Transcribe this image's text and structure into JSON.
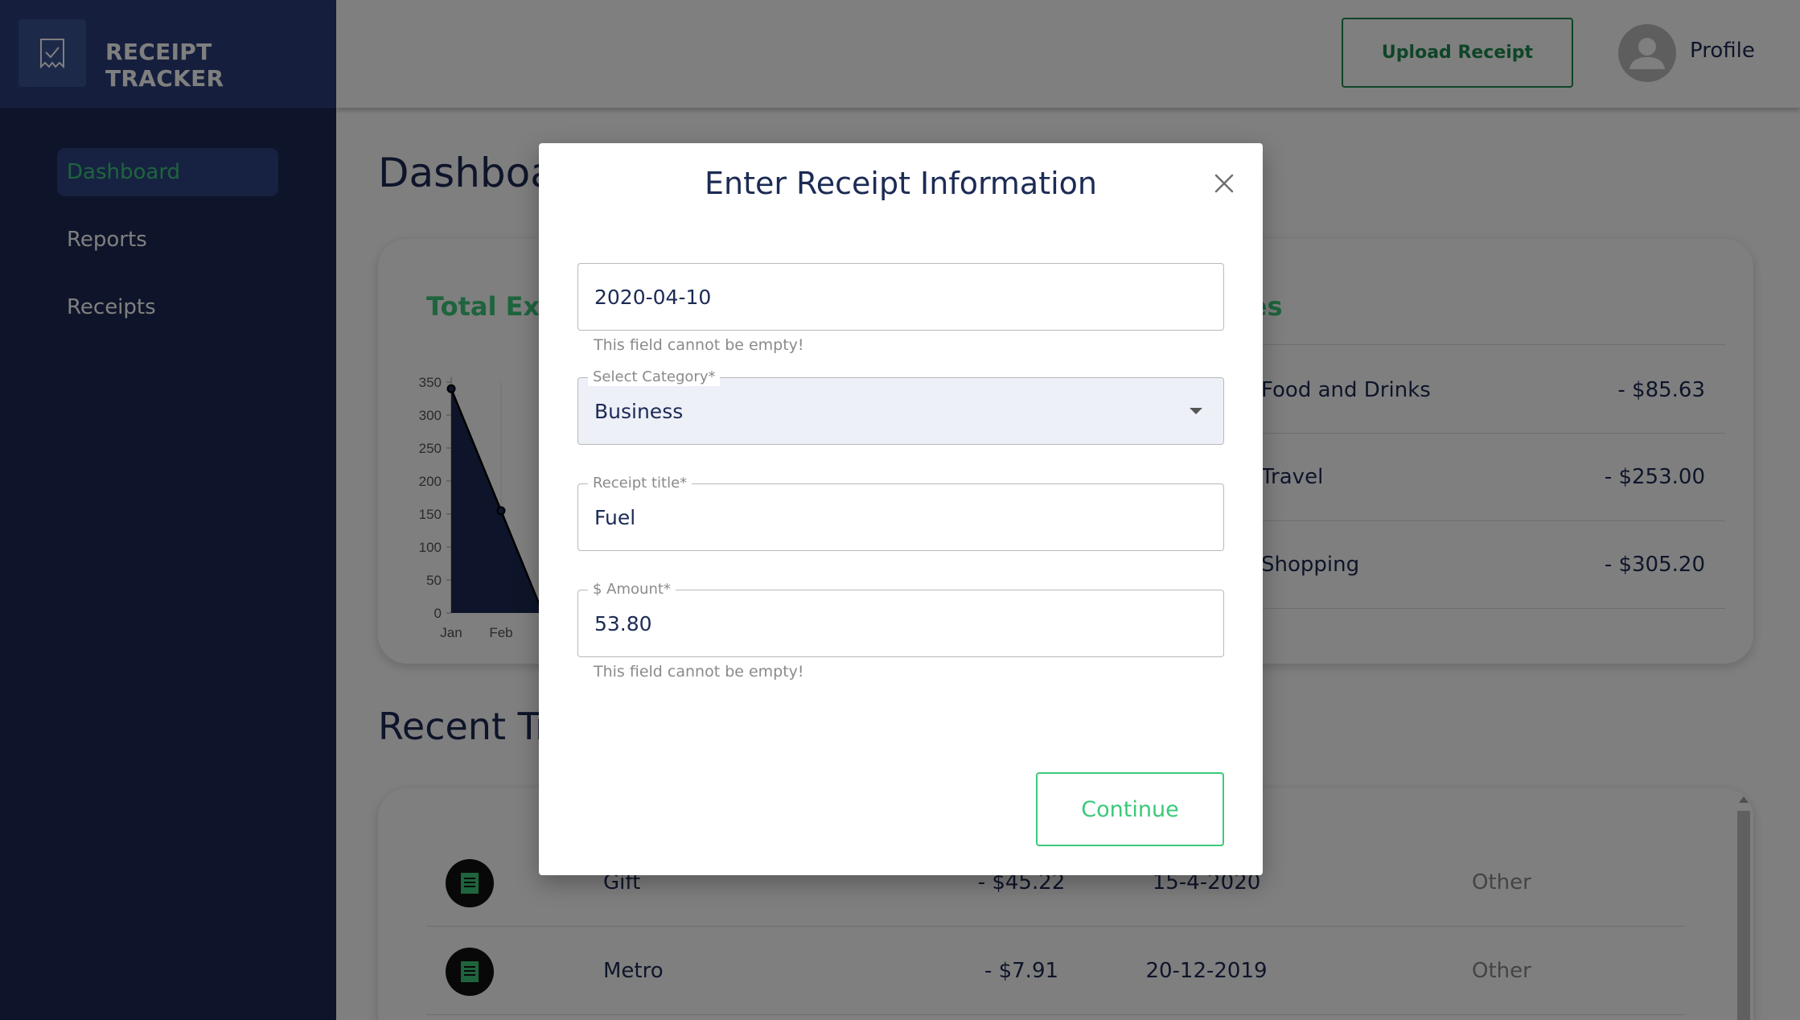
{
  "app": {
    "brand": "RECEIPT TRACKER"
  },
  "sidebar": {
    "items": [
      {
        "label": "Dashboard",
        "active": true
      },
      {
        "label": "Reports",
        "active": false
      },
      {
        "label": "Receipts",
        "active": false
      }
    ]
  },
  "topbar": {
    "upload_label": "Upload Receipt",
    "profile_label": "Profile"
  },
  "main": {
    "title": "Dashboa",
    "expense_title": "Total Exp",
    "categories_title": "ories",
    "categories": [
      {
        "name": "Food and Drinks",
        "amount": "- $85.63"
      },
      {
        "name": "Travel",
        "amount": "- $253.00"
      },
      {
        "name": "Shopping",
        "amount": "- $305.20"
      }
    ],
    "recent_title": "Recent Tr",
    "transactions": [
      {
        "title": "Gift",
        "amount": "- $45.22",
        "date": "15-4-2020",
        "category": "Other"
      },
      {
        "title": "Metro",
        "amount": "- $7.91",
        "date": "20-12-2019",
        "category": "Other"
      }
    ]
  },
  "chart_data": {
    "type": "area",
    "x": [
      "Jan",
      "Feb"
    ],
    "series": [
      {
        "values": [
          340,
          155
        ]
      }
    ],
    "yticks": [
      0,
      50,
      100,
      150,
      200,
      250,
      300,
      350
    ],
    "ylim": [
      0,
      350
    ],
    "grid": true,
    "fill_color": "#1c2b55"
  },
  "modal": {
    "title": "Enter Receipt Information",
    "date_value": "2020-04-10",
    "date_helper": "This field cannot be empty!",
    "category_label": "Select Category*",
    "category_value": "Business",
    "title_label": "Receipt title*",
    "title_value": "Fuel",
    "amount_label": "$ Amount*",
    "amount_value": "53.80",
    "amount_helper": "This field cannot be empty!",
    "continue_label": "Continue"
  },
  "colors": {
    "navy": "#1c2b55",
    "green": "#3cc97a",
    "dark_green": "#1d8a4e"
  }
}
